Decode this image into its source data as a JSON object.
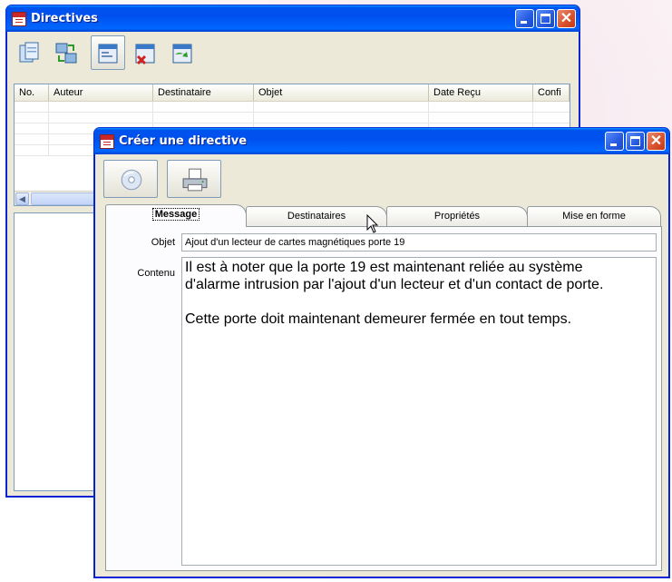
{
  "bg_window": {
    "title": "Directives",
    "toolbar": [
      {
        "icon": "new-document-icon"
      },
      {
        "icon": "transfer-icon"
      },
      {
        "icon": "form-icon"
      },
      {
        "icon": "delete-form-icon"
      },
      {
        "icon": "refresh-form-icon"
      }
    ],
    "columns": [
      "No.",
      "Auteur",
      "Destinataire",
      "Objet",
      "Date Reçu",
      "Confi"
    ]
  },
  "dialog": {
    "title": "Créer une directive",
    "toolbar": [
      {
        "icon": "send-disc-icon"
      },
      {
        "icon": "print-icon"
      }
    ],
    "tabs": [
      {
        "label": "Message"
      },
      {
        "label": "Destinataires"
      },
      {
        "label": "Propriétés"
      },
      {
        "label": "Mise en forme"
      }
    ],
    "objet_label": "Objet",
    "objet_value": "Ajout d'un lecteur de cartes magnétiques porte 19",
    "contenu_label": "Contenu",
    "contenu_lines": [
      "Il est à noter que la porte 19 est maintenant reliée au système",
      "d'alarme intrusion par l'ajout d'un lecteur et d'un contact de porte.",
      "",
      "Cette porte doit maintenant demeurer fermée en tout temps."
    ]
  },
  "colors": {
    "titlebar": "#0058ee",
    "window_face": "#ece9d8",
    "close_button": "#d8502b"
  }
}
